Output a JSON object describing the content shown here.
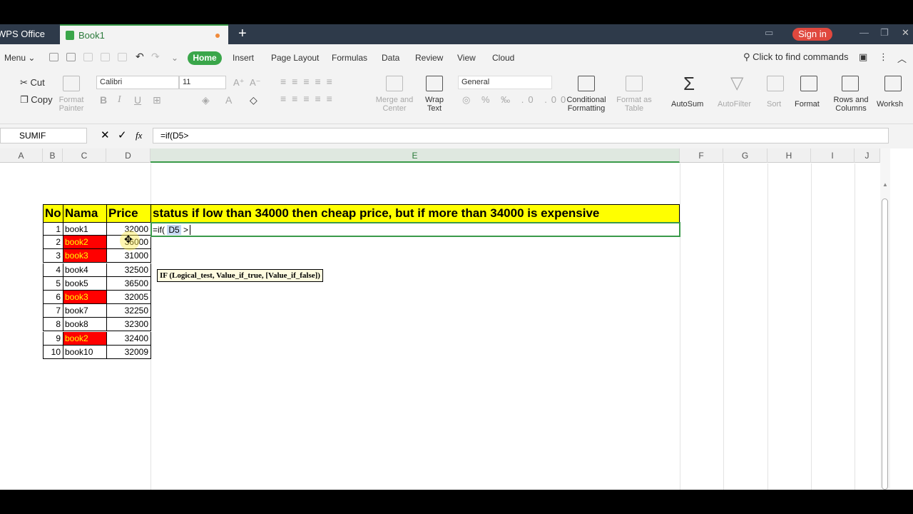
{
  "titlebar": {
    "app_name": "WPS Office",
    "doc_tab": "Book1",
    "add_tab": "+",
    "signin": "Sign in"
  },
  "menubar": {
    "menu": "Menu",
    "tabs": [
      "Home",
      "Insert",
      "Page Layout",
      "Formulas",
      "Data",
      "Review",
      "View",
      "Cloud"
    ],
    "find": "Click to find commands"
  },
  "ribbon": {
    "cut": "Cut",
    "copy": "Copy",
    "format_painter": "Format Painter",
    "font_name": "Calibri",
    "font_size": "11",
    "merge_center": "Merge and Center",
    "wrap_text": "Wrap Text",
    "number_format": "General",
    "conditional_formatting": "Conditional Formatting",
    "format_as_table": "Format as Table",
    "autosum": "AutoSum",
    "autofilter": "AutoFilter",
    "sort": "Sort",
    "format": "Format",
    "rows_columns": "Rows and Columns",
    "worksheet": "Worksh"
  },
  "formula_bar": {
    "name_box": "SUMIF",
    "fx": "fx",
    "formula": "=if(D5>"
  },
  "columns": [
    "A",
    "B",
    "C",
    "D",
    "E",
    "F",
    "G",
    "H",
    "I",
    "J"
  ],
  "table": {
    "headers": [
      "No",
      "Nama",
      "Price",
      "status if low than 34000 then cheap price, but if more than 34000 is expensive"
    ],
    "rows": [
      {
        "no": "1",
        "name": "book1",
        "price": "32000",
        "highlight": false
      },
      {
        "no": "2",
        "name": "book2",
        "price": "36000",
        "highlight": true
      },
      {
        "no": "3",
        "name": "book3",
        "price": "31000",
        "highlight": true
      },
      {
        "no": "4",
        "name": "book4",
        "price": "32500",
        "highlight": false
      },
      {
        "no": "5",
        "name": "book5",
        "price": "36500",
        "highlight": false
      },
      {
        "no": "6",
        "name": "book3",
        "price": "32005",
        "highlight": true
      },
      {
        "no": "7",
        "name": "book7",
        "price": "32250",
        "highlight": false
      },
      {
        "no": "8",
        "name": "book8",
        "price": "32300",
        "highlight": false
      },
      {
        "no": "9",
        "name": "book2",
        "price": "32400",
        "highlight": true
      },
      {
        "no": "10",
        "name": "book10",
        "price": "32009",
        "highlight": false
      }
    ],
    "editing_cell": "=if( D5 >",
    "editing_ref": "D5",
    "tooltip": "IF (Logical_test, Value_if_true, [Value_if_false])"
  },
  "colors": {
    "header_fill": "#ffff00",
    "highlight_fill": "#ff0000",
    "highlight_text": "#ffff00",
    "accent": "#3aa64a"
  }
}
